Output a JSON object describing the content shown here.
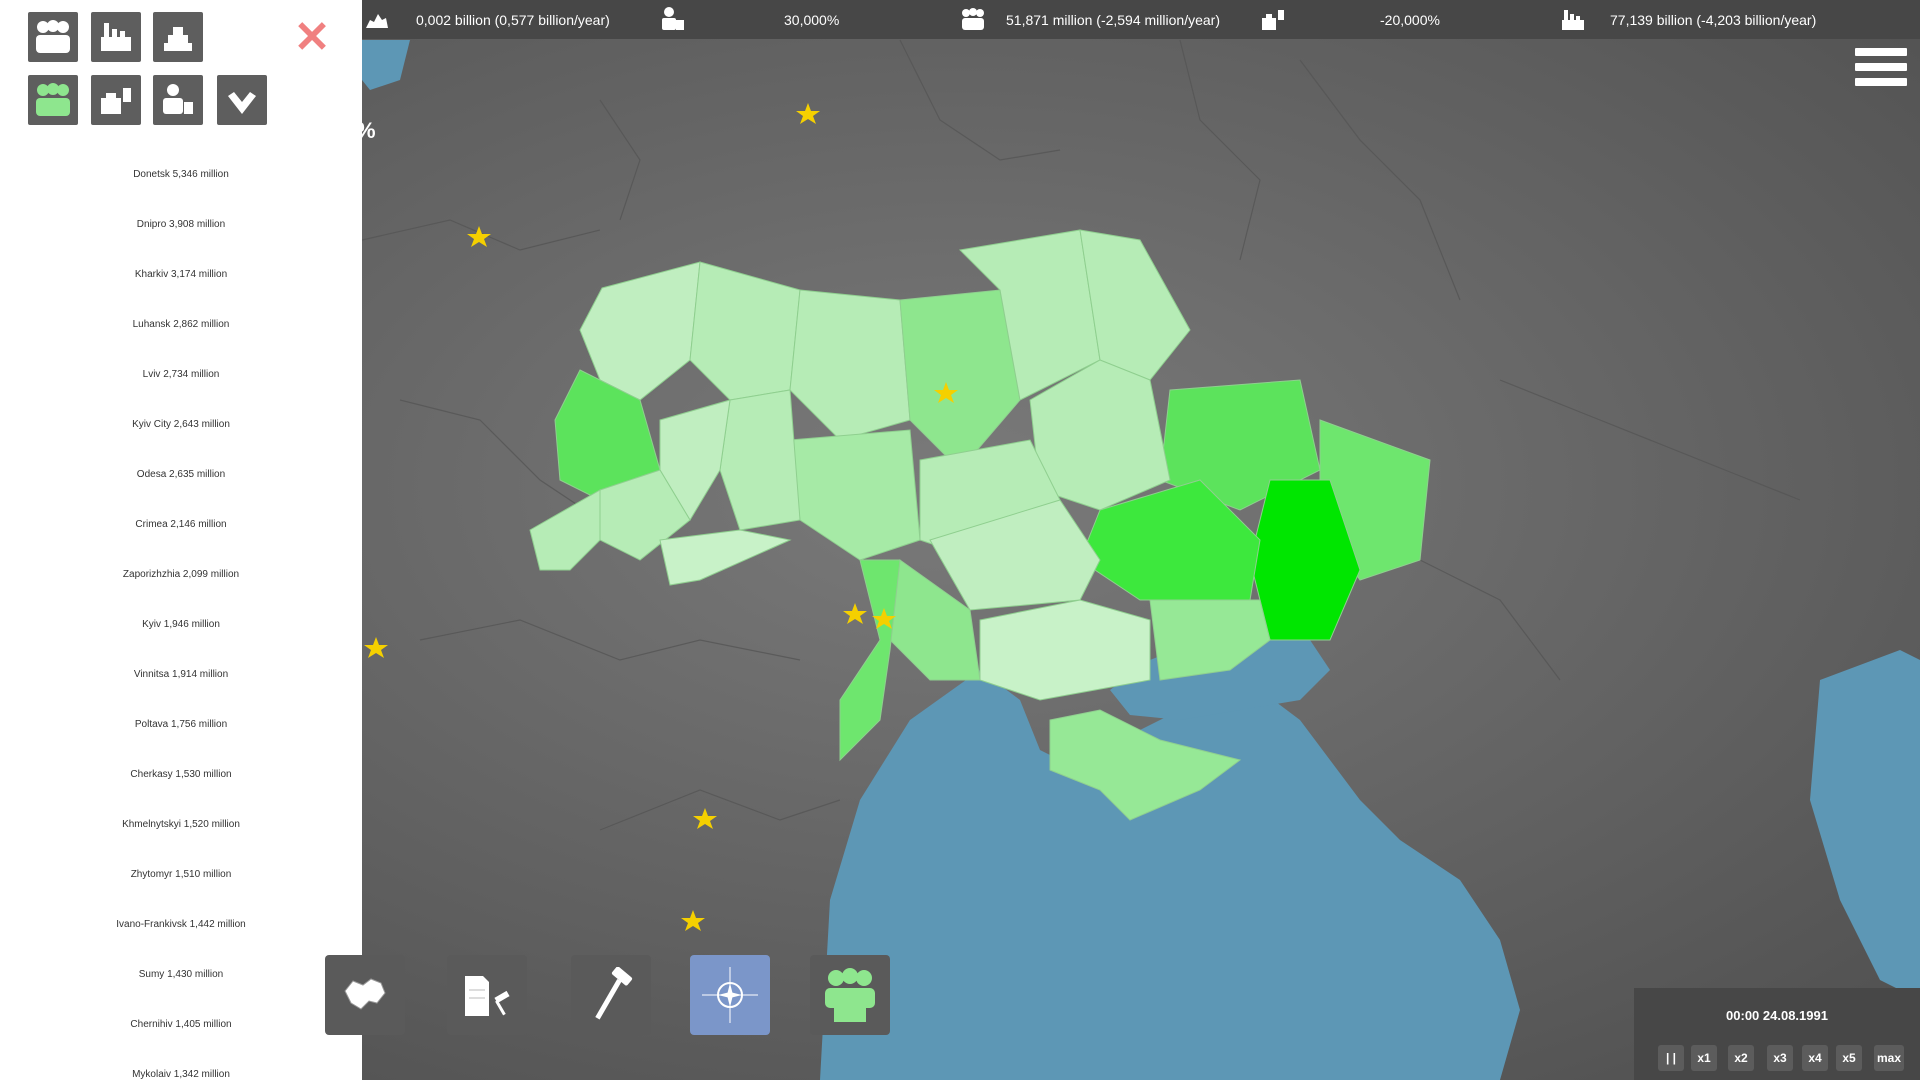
{
  "top_bar": {
    "stat_1": "0,002 billion (0,577 billion/year)",
    "stat_2": "30,000%",
    "stat_3": "51,871 million (-2,594 million/year)",
    "stat_4": "-20,000%",
    "stat_5": "77,139 billion (-4,203 billion/year)"
  },
  "sidebar": {
    "close_icon": "close-icon",
    "categories": [
      "population-icon",
      "industry-icon",
      "resources-icon",
      "ethnic-population-icon",
      "business-icon",
      "employment-icon",
      "approval-icon"
    ],
    "regions": [
      "Donetsk 5,346 million",
      "Dnipro 3,908 million",
      "Kharkiv 3,174 million",
      "Luhansk 2,862 million",
      "Lviv 2,734 million",
      "Kyiv City 2,643 million",
      "Odesa 2,635 million",
      "Crimea 2,146 million",
      "Zaporizhzhia 2,099 million",
      "Kyiv 1,946 million",
      "Vinnitsa 1,914 million",
      "Poltava 1,756 million",
      "Cherkasy 1,530 million",
      "Khmelnytskyi 1,520 million",
      "Zhytomyr 1,510 million",
      "Ivano-Frankivsk 1,442 million",
      "Sumy 1,430 million",
      "Chernihiv 1,405 million",
      "Mykolaiv 1,342 million"
    ]
  },
  "map": {
    "partial_label": "%"
  },
  "toolbar": {
    "tools": [
      "regions-map-icon",
      "laws-gavel-icon",
      "build-hammer-icon",
      "nato-icon",
      "population-icon"
    ],
    "selected": "nato-icon"
  },
  "time_panel": {
    "datetime": "00:00 24.08.1991",
    "speeds": [
      "| |",
      "x1",
      "x2",
      "x3",
      "x4",
      "x5",
      "max"
    ]
  },
  "colors": {
    "sidebar_bg": "#ffffff",
    "topbar_bg": "#474747",
    "map_land": "#6b6b6b",
    "sea": "#5d97b5",
    "close": "#f08080",
    "selected_tool": "#7b96c9",
    "ukraine_light": "#c8f2c8",
    "ukraine_dark": "#00e600"
  }
}
